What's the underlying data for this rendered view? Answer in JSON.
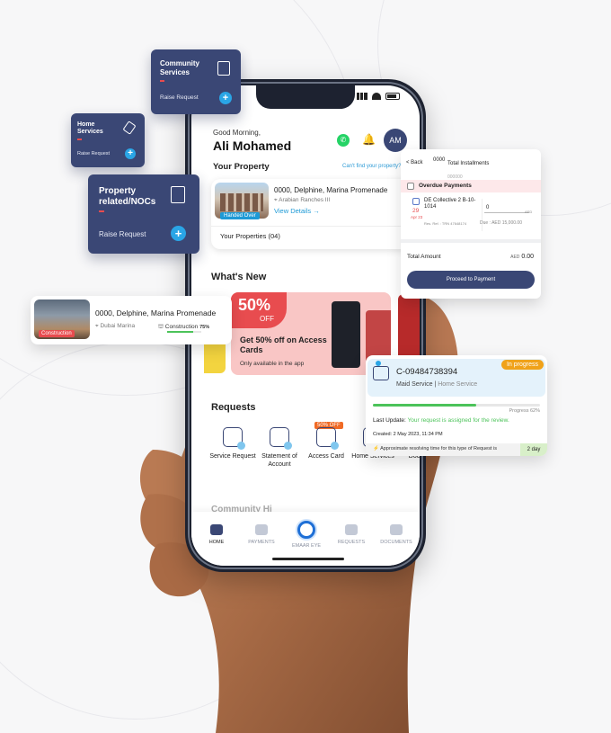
{
  "phone": {
    "greeting": "Good Morning,",
    "user_name": "Ali Mohamed",
    "avatar_initials": "AM",
    "your_property_label": "Your Property",
    "cant_find_label": "Can't find your property?",
    "property": {
      "title": "0000, Delphine, Marina Promenade",
      "location": "Arabian Ranches III",
      "badge": "Handed Over",
      "view_details": "View Details →"
    },
    "your_properties_label": "Your Properties (04)",
    "whats_new_label": "What's New",
    "promo": {
      "percent": "50%",
      "off": "OFF",
      "headline": "Get 50% off on Access Cards",
      "subline": "Only available in the app"
    },
    "requests_label": "Requests",
    "requests": [
      {
        "label": "Service Request"
      },
      {
        "label": "Statement of Account"
      },
      {
        "label": "Access Card",
        "badge": "50% OFF"
      },
      {
        "label": "Home Services"
      },
      {
        "label": "Doc"
      }
    ],
    "community_partial": "Community Hi",
    "tabs": [
      {
        "label": "HOME",
        "icon": "home-icon"
      },
      {
        "label": "PAYMENTS",
        "icon": "card-icon"
      },
      {
        "label": "EMAAR EYE",
        "icon": "eye-icon"
      },
      {
        "label": "REQUESTS",
        "icon": "requests-icon"
      },
      {
        "label": "DOCUMENTS",
        "icon": "documents-icon"
      }
    ]
  },
  "cards": {
    "community": {
      "title": "Community Services",
      "action": "Raise Request"
    },
    "home": {
      "title": "Home Services",
      "action": "Raise Request"
    },
    "noc": {
      "title": "Property related/NOCs",
      "action": "Raise Request"
    },
    "construction": {
      "title": "0000, Delphine, Marina Promenade",
      "location": "Dubai Marina",
      "status": "Construction",
      "percent": "75%",
      "progress": 0.75,
      "badge": "Construction"
    },
    "installments": {
      "back": "< Back",
      "number": "0000",
      "title": "Total Installments",
      "number_small": "000000",
      "section": "Overdue Payments",
      "item_title": "DE Collective 2 B-10-1014",
      "day": "29",
      "month": "Apr 23",
      "ref": "Res. Ref. : TRN 47648174",
      "amount_input": "0",
      "aed_small": "AED",
      "due": "Due : AED 15,000.00",
      "total_label": "Total Amount",
      "total_currency": "AED",
      "total_value": "0.00",
      "button": "Proceed to Payment"
    },
    "maid": {
      "id": "C-09484738394",
      "service": "Maid Service",
      "category": "Home Service",
      "status": "In progress",
      "progress_text": "Progress 62%",
      "progress": 0.62,
      "last_update_label": "Last Update:",
      "last_update_text": "Your request is assigned for the review.",
      "created": "Created: 2 May 2023, 11:34 PM",
      "resolve_text": "⚡ Approximate resolving time for this type of Request is",
      "resolve_value": "2 day"
    }
  }
}
